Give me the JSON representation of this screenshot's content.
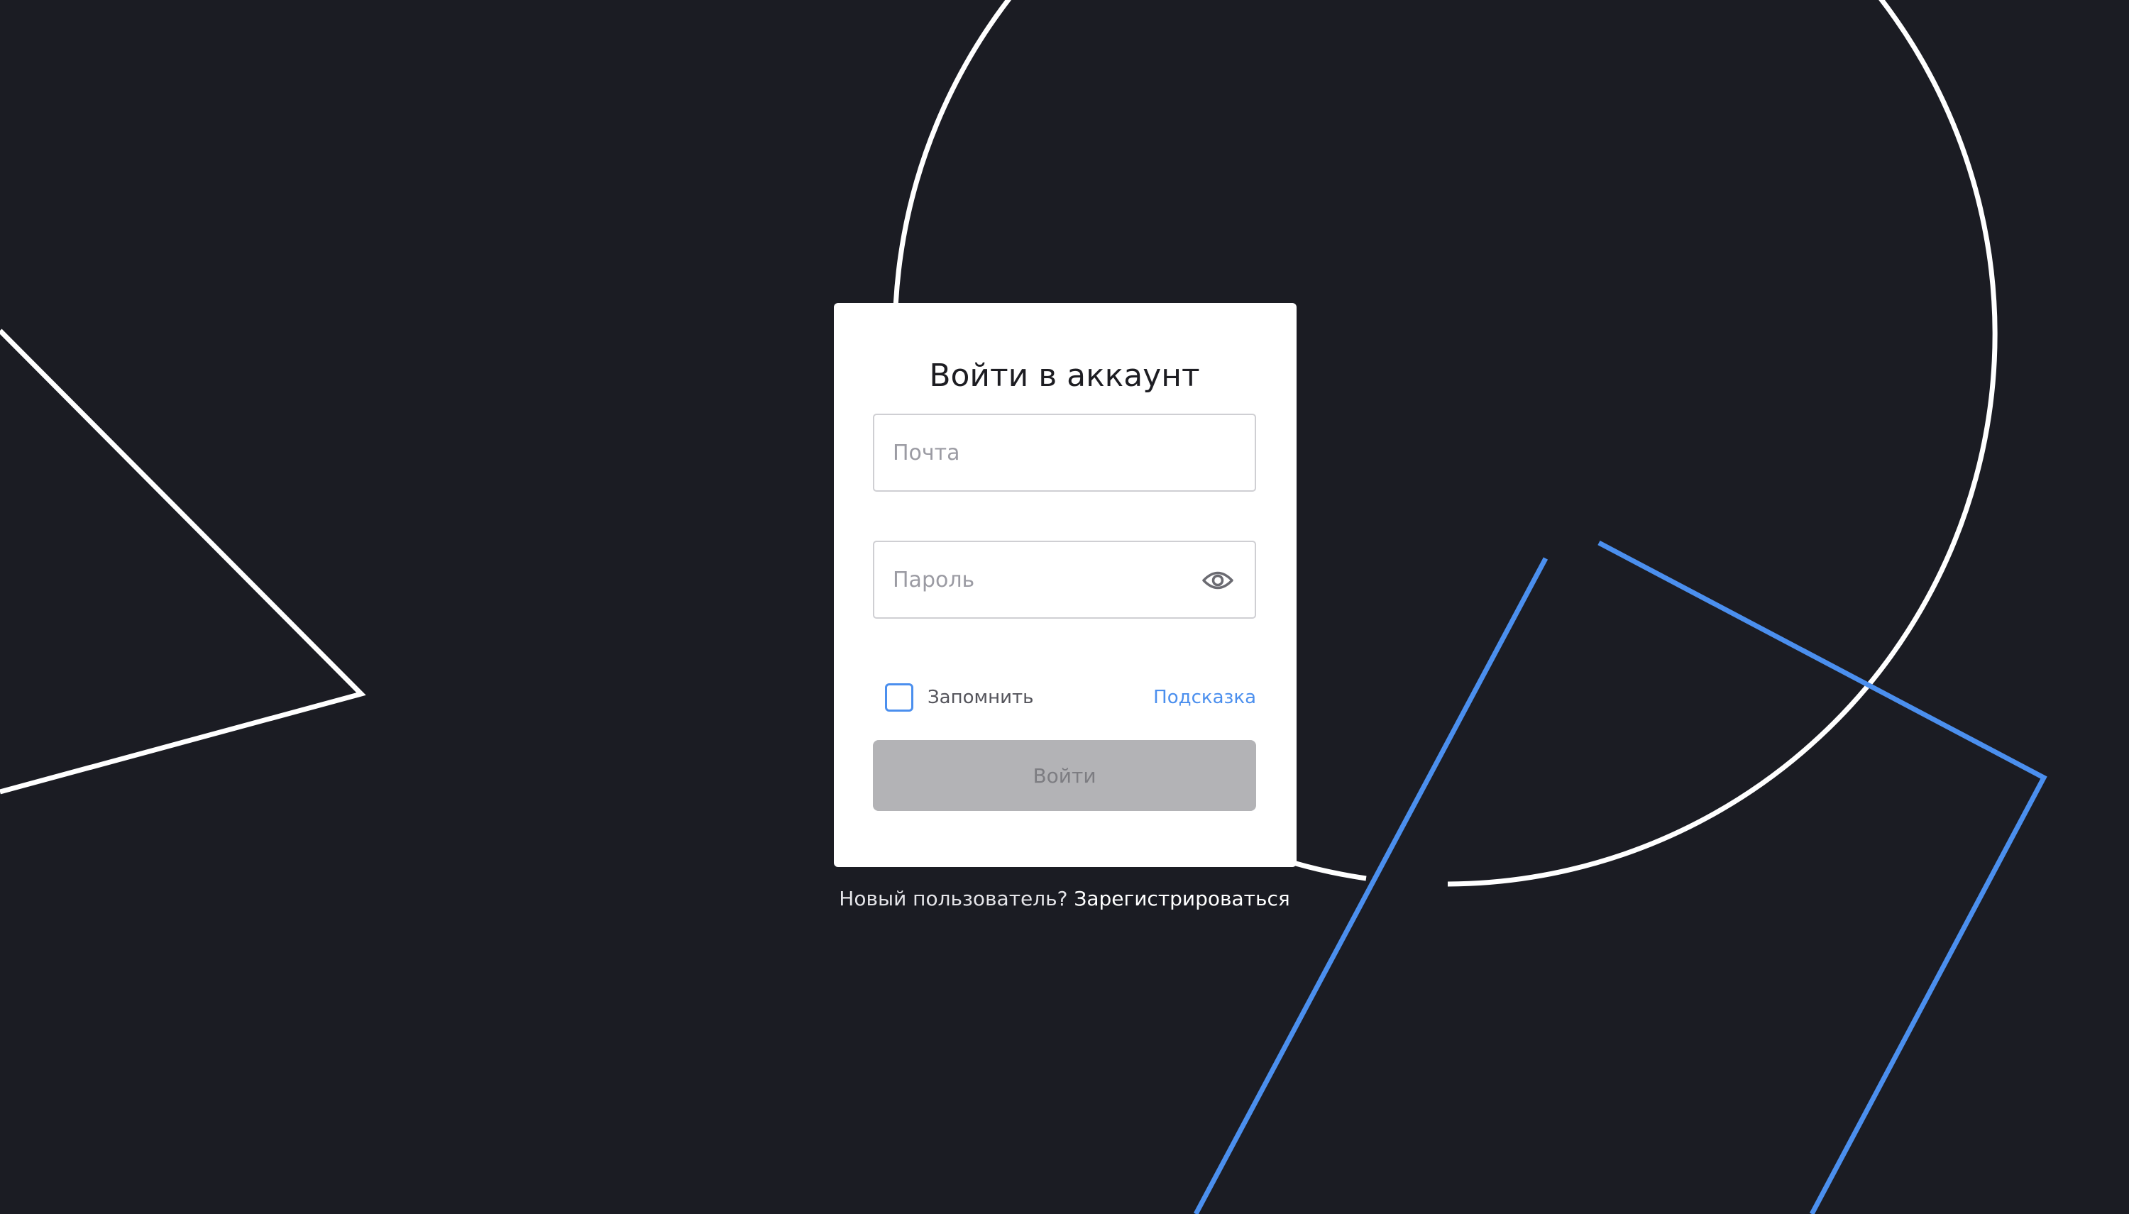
{
  "colors": {
    "background": "#1b1c23",
    "card": "#ffffff",
    "accent": "#4b8fee",
    "button_disabled": "#b3b3b6"
  },
  "login": {
    "title": "Войти в аккаунт",
    "email_placeholder": "Почта",
    "email_value": "",
    "password_placeholder": "Пароль",
    "password_value": "",
    "password_toggle_icon": "eye-icon",
    "remember_label": "Запомнить",
    "remember_checked": false,
    "hint_link": "Подсказка",
    "submit_label": "Войти",
    "submit_disabled": true
  },
  "footer": {
    "new_user_prompt": "Новый пользователь?",
    "register_link": "Зарегистрироваться"
  }
}
